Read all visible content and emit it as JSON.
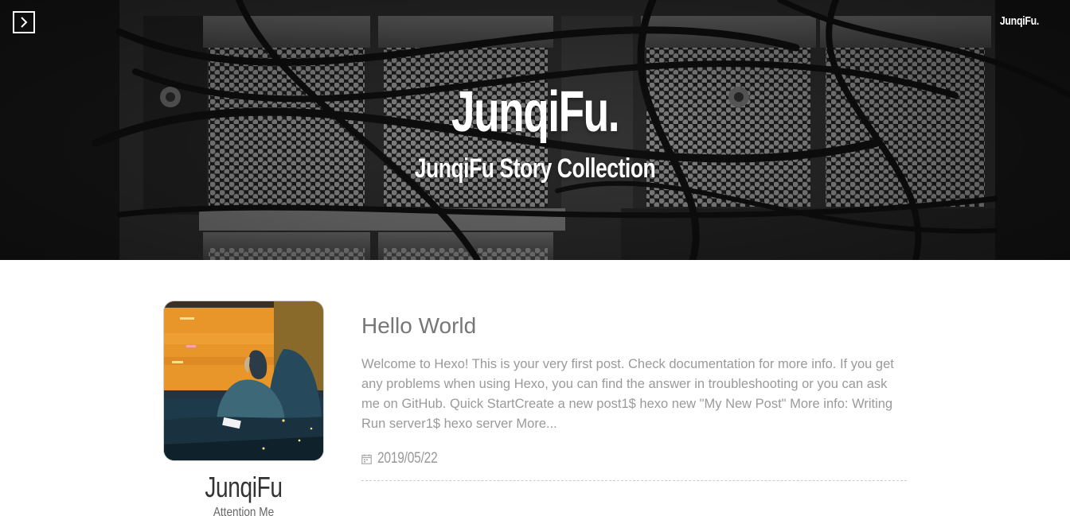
{
  "header": {
    "brand": "JunqiFu.",
    "title": "JunqiFu.",
    "subtitle": "JunqiFu Story Collection",
    "menu_icon": "chevron-right-icon"
  },
  "profile": {
    "name": "JunqiFu",
    "tagline": "Attention Me"
  },
  "posts": [
    {
      "title": "Hello World",
      "excerpt": "Welcome to Hexo! This is your very first post. Check documentation for more info. If you get any problems when using Hexo, you can find the answer in troubleshooting or you can ask me on GitHub. Quick StartCreate a new post1$ hexo new \"My New Post\" More info: Writing Run server1$ hexo server More...",
      "date": "2019/05/22",
      "date_icon": "calendar-icon"
    }
  ],
  "colors": {
    "hero_text": "#ffffff",
    "post_title": "#777777",
    "post_text": "#9a9a9a",
    "profile_name": "#333333",
    "divider": "#cccccc"
  }
}
